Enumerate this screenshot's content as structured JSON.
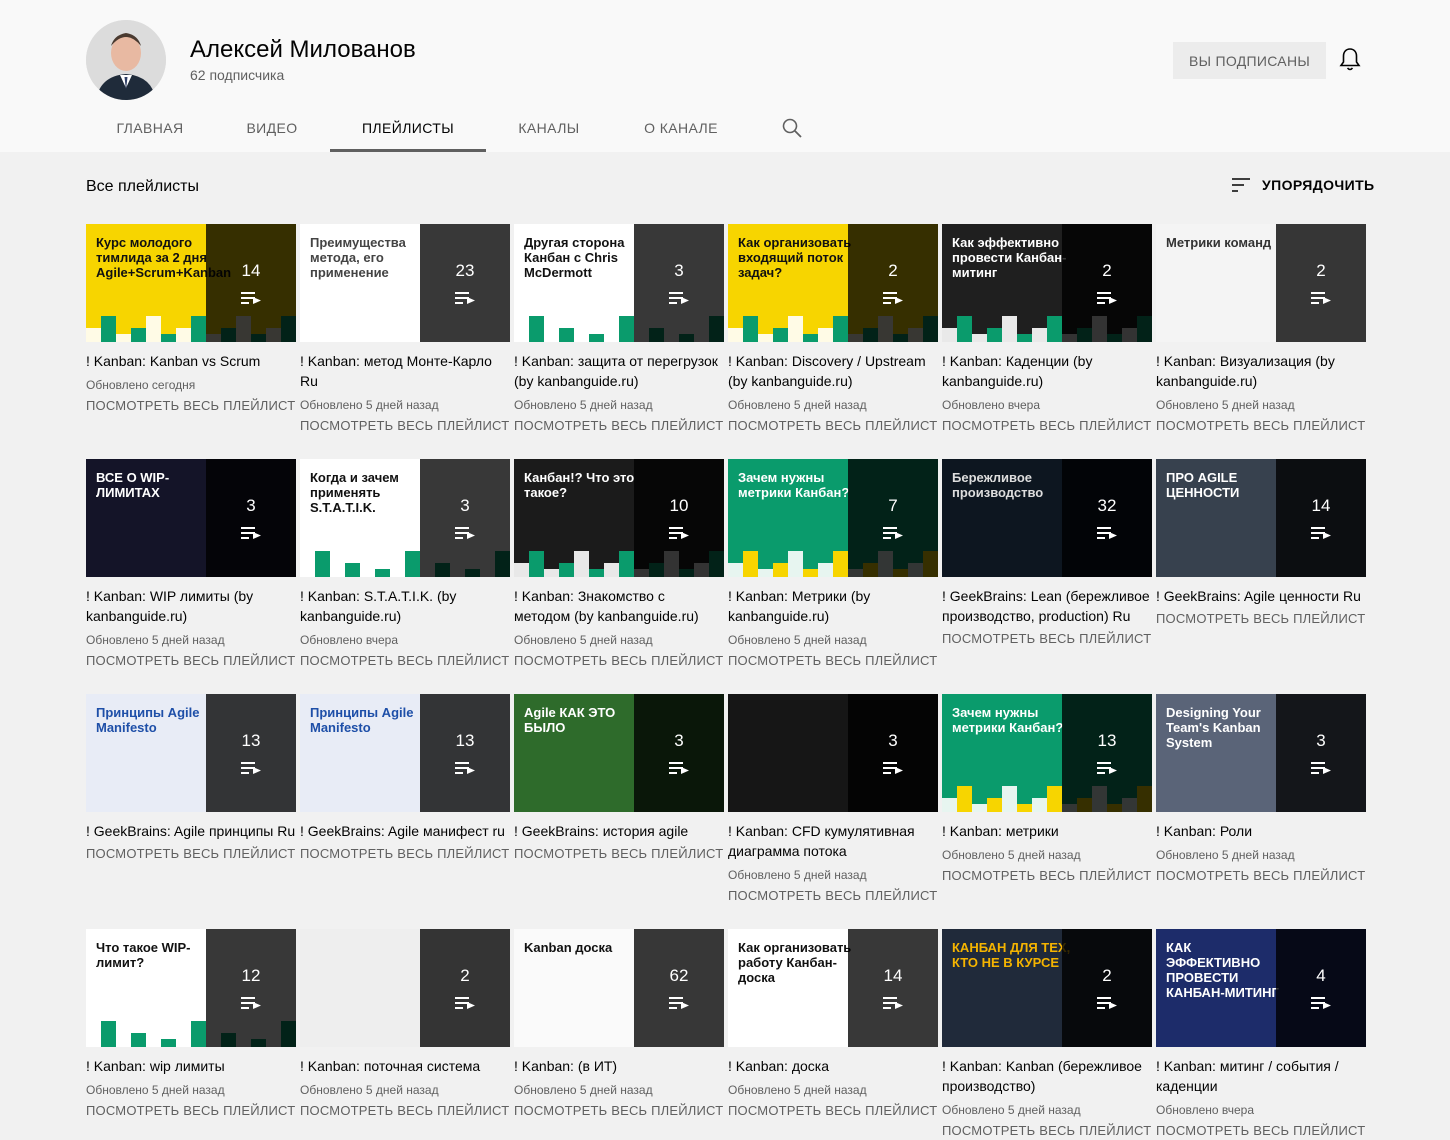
{
  "channel": {
    "name": "Алексей Милованов",
    "subscribers": "62 подписчика",
    "subscribe_label": "ВЫ ПОДПИСАНЫ"
  },
  "tabs": [
    {
      "label": "ГЛАВНАЯ"
    },
    {
      "label": "ВИДЕО"
    },
    {
      "label": "ПЛЕЙЛИСТЫ"
    },
    {
      "label": "КАНАЛЫ"
    },
    {
      "label": "О КАНАЛЕ"
    }
  ],
  "section": {
    "title": "Все плейлисты",
    "sort_label": "УПОРЯДОЧИТЬ"
  },
  "view_all": "ПОСМОТРЕТЬ ВЕСЬ ПЛЕЙЛИСТ",
  "playlists": [
    {
      "title": "! Kanban: Kanban vs Scrum",
      "count": "14",
      "updated": "Обновлено сегодня",
      "thumb": "Курс молодого тимлида за 2 дня Agile+Scrum+Kanban"
    },
    {
      "title": "! Kanban: метод Монте-Карло Ru",
      "count": "23",
      "updated": "Обновлено 5 дней назад",
      "thumb": "Преимущества метода, его применение"
    },
    {
      "title": "! Kanban: защита от перегрузок (by kanbanguide.ru)",
      "count": "3",
      "updated": "Обновлено 5 дней назад",
      "thumb": "Другая сторона Канбан с Chris McDermott"
    },
    {
      "title": "! Kanban: Discovery / Upstream (by kanbanguide.ru)",
      "count": "2",
      "updated": "Обновлено 5 дней назад",
      "thumb": "Как организовать входящий поток задач?"
    },
    {
      "title": "! Kanban: Каденции (by kanbanguide.ru)",
      "count": "2",
      "updated": "Обновлено вчера",
      "thumb": "Как эффективно провести Канбан-митинг"
    },
    {
      "title": "! Kanban: Визуализация (by kanbanguide.ru)",
      "count": "2",
      "updated": "Обновлено 5 дней назад",
      "thumb": "Метрики команд"
    },
    {
      "title": "! Kanban: WIP лимиты (by kanbanguide.ru)",
      "count": "3",
      "updated": "Обновлено 5 дней назад",
      "thumb": "ВСЕ О WIP-ЛИМИТАХ"
    },
    {
      "title": "! Kanban: S.T.A.T.I.K. (by kanbanguide.ru)",
      "count": "3",
      "updated": "Обновлено вчера",
      "thumb": "Когда и зачем применять S.T.A.T.I.K."
    },
    {
      "title": "! Kanban: Знакомство с методом (by kanbanguide.ru)",
      "count": "10",
      "updated": "Обновлено 5 дней назад",
      "thumb": "Канбан!? Что это такое?"
    },
    {
      "title": "! Kanban: Метрики (by kanbanguide.ru)",
      "count": "7",
      "updated": "Обновлено 5 дней назад",
      "thumb": "Зачем нужны метрики Канбан?"
    },
    {
      "title": "! GeekBrains: Lean (бережливое производство, production) Ru",
      "count": "32",
      "updated": "",
      "thumb": "Бережливое производство"
    },
    {
      "title": "! GeekBrains: Agile ценности Ru",
      "count": "14",
      "updated": "",
      "thumb": "ПРО AGILE ЦЕННОСТИ"
    },
    {
      "title": "! GeekBrains: Agile принципы Ru",
      "count": "13",
      "updated": "",
      "thumb": "Принципы Agile Manifesto"
    },
    {
      "title": "! GeekBrains: Agile манифест ru",
      "count": "13",
      "updated": "",
      "thumb": "Принципы Agile Manifesto"
    },
    {
      "title": "! GeekBrains: история agile",
      "count": "3",
      "updated": "",
      "thumb": "Agile КАК ЭТО БЫЛО"
    },
    {
      "title": "! Kanban: CFD кумулятивная диаграмма потока",
      "count": "3",
      "updated": "Обновлено 5 дней назад",
      "thumb": ""
    },
    {
      "title": "! Kanban: метрики",
      "count": "13",
      "updated": "Обновлено 5 дней назад",
      "thumb": "Зачем нужны метрики Канбан?"
    },
    {
      "title": "! Kanban: Роли",
      "count": "3",
      "updated": "Обновлено 5 дней назад",
      "thumb": "Designing Your Team's Kanban System"
    },
    {
      "title": "! Kanban: wip лимиты",
      "count": "12",
      "updated": "Обновлено 5 дней назад",
      "thumb": "Что такое WIP-лимит?"
    },
    {
      "title": "! Kanban: поточная система",
      "count": "2",
      "updated": "Обновлено 5 дней назад",
      "thumb": ""
    },
    {
      "title": "! Kanban: (в ИТ)",
      "count": "62",
      "updated": "Обновлено 5 дней назад",
      "thumb": "Kanban доска"
    },
    {
      "title": "! Kanban: доска",
      "count": "14",
      "updated": "Обновлено 5 дней назад",
      "thumb": "Как организовать работу Канбан-доска"
    },
    {
      "title": "! Kanban: Kanban (бережливое производство)",
      "count": "2",
      "updated": "Обновлено 5 дней назад",
      "thumb": "КАНБАН ДЛЯ ТЕХ, КТО НЕ В КУРСЕ"
    },
    {
      "title": "! Kanban: митинг / события / каденции",
      "count": "4",
      "updated": "Обновлено вчера",
      "thumb": "КАК ЭФФЕКТИВНО ПРОВЕСТИ КАНБАН-МИТИНГ"
    }
  ],
  "colors": {
    "accent_yellow": "#f7d500",
    "accent_green": "#0a9b6c",
    "dark": "#1c1c1c"
  }
}
